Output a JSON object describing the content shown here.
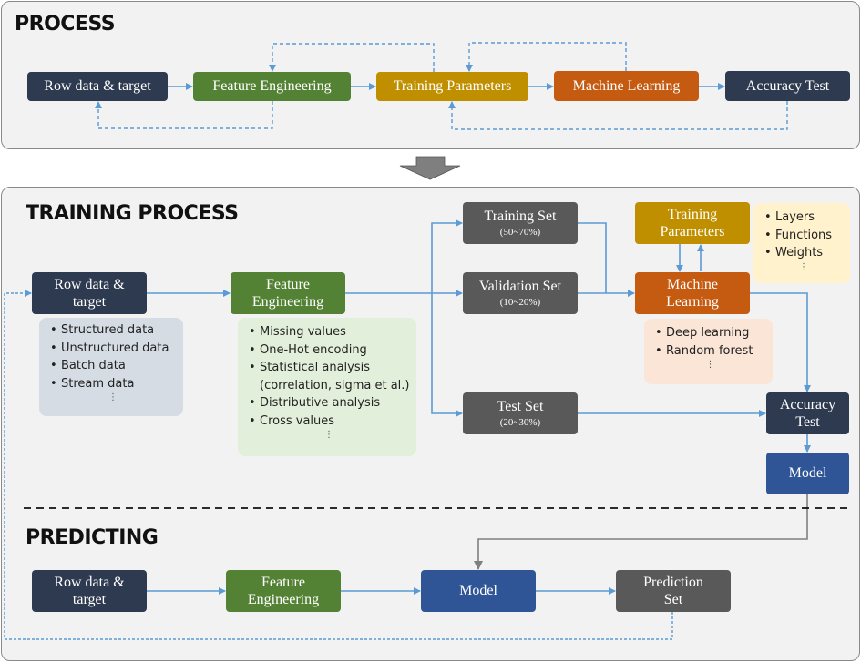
{
  "process": {
    "title": "PROCESS",
    "steps": [
      "Row data & target",
      "Feature Engineering",
      "Training Parameters",
      "Machine Learning",
      "Accuracy Test"
    ]
  },
  "training": {
    "title": "TRAINING PROCESS",
    "row_data": {
      "line1": "Row data &",
      "line2": "target"
    },
    "row_data_notes": [
      "Structured data",
      "Unstructured data",
      "Batch data",
      "Stream data"
    ],
    "feature_eng": {
      "line1": "Feature",
      "line2": "Engineering"
    },
    "feature_notes": [
      {
        "text": "Missing values"
      },
      {
        "text": "One-Hot encoding"
      },
      {
        "text": "Statistical analysis"
      },
      {
        "text": "(correlation, sigma et al.)",
        "continuation": true
      },
      {
        "text": "Distributive analysis"
      },
      {
        "text": "Cross values"
      }
    ],
    "training_set": {
      "label": "Training Set",
      "range": "(50~70%)"
    },
    "validation_set": {
      "label": "Validation Set",
      "range": "(10~20%)"
    },
    "test_set": {
      "label": "Test Set",
      "range": "(20~30%)"
    },
    "training_params": {
      "line1": "Training",
      "line2": "Parameters"
    },
    "param_notes": [
      "Layers",
      "Functions",
      "Weights"
    ],
    "machine_learning": {
      "line1": "Machine",
      "line2": "Learning"
    },
    "ml_notes": [
      "Deep learning",
      "Random forest"
    ],
    "accuracy_test": {
      "line1": "Accuracy",
      "line2": "Test"
    },
    "model": "Model"
  },
  "predicting": {
    "title": "PREDICTING",
    "row_data": {
      "line1": "Row data &",
      "line2": "target"
    },
    "feature_eng": {
      "line1": "Feature",
      "line2": "Engineering"
    },
    "model": "Model",
    "prediction_set": {
      "line1": "Prediction",
      "line2": "Set"
    }
  },
  "symbols": {
    "bullet": "•",
    "ellipsis": "⋮"
  },
  "colors": {
    "navy": "#2e3a50",
    "green": "#548235",
    "gold": "#bf8f00",
    "orange": "#c55a11",
    "gray": "#595959",
    "blue": "#2f5597",
    "connector": "#5b9bd5"
  }
}
